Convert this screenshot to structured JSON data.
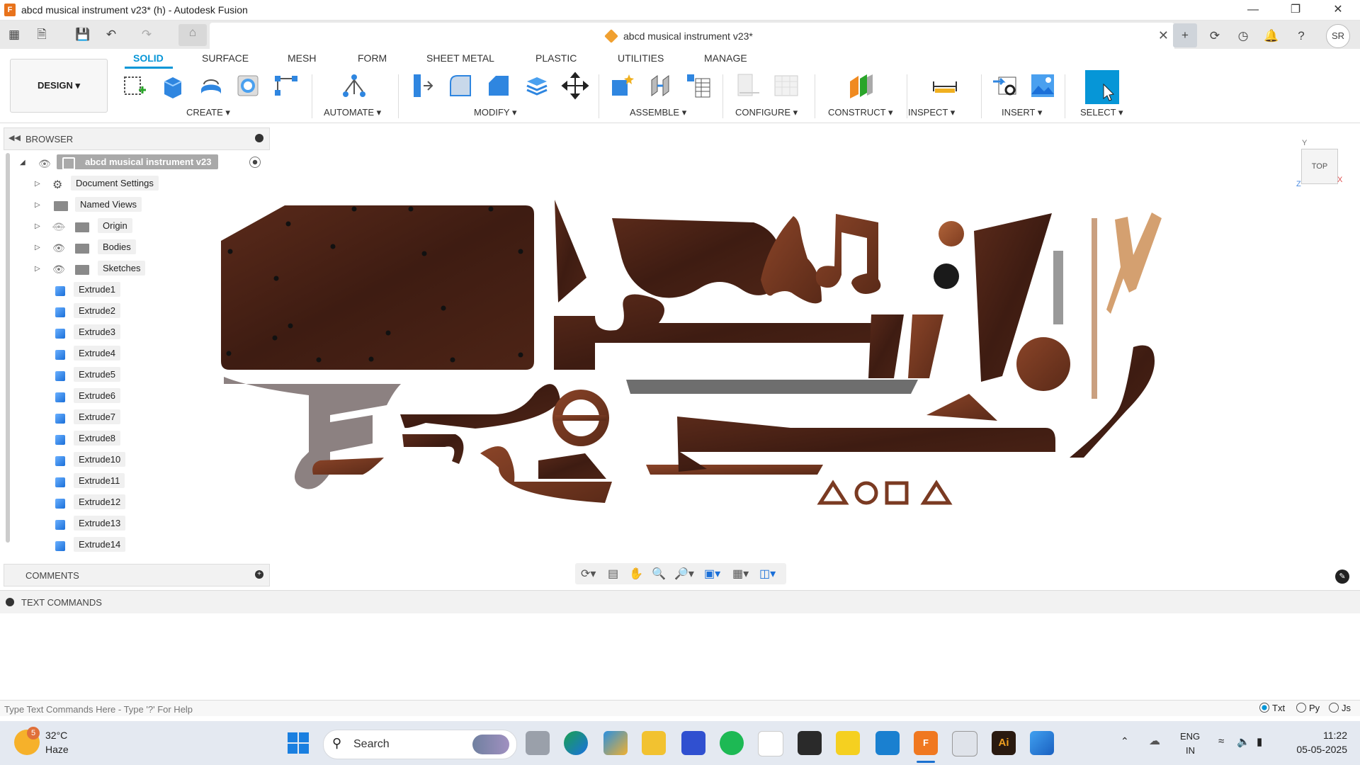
{
  "window": {
    "title": "abcd musical instrument v23* (h) - Autodesk Fusion",
    "app_icon": "F"
  },
  "tab": {
    "name": "abcd musical instrument v23*"
  },
  "ribbon": {
    "workspace": "DESIGN",
    "tabs": [
      "SOLID",
      "SURFACE",
      "MESH",
      "FORM",
      "SHEET METAL",
      "PLASTIC",
      "UTILITIES",
      "MANAGE"
    ],
    "groups": [
      "CREATE",
      "AUTOMATE",
      "MODIFY",
      "ASSEMBLE",
      "CONFIGURE",
      "CONSTRUCT",
      "INSPECT",
      "INSERT",
      "SELECT"
    ]
  },
  "browser": {
    "title": "BROWSER",
    "root": "abcd musical instrument v23",
    "folders": [
      "Document Settings",
      "Named Views",
      "Origin",
      "Bodies",
      "Sketches"
    ],
    "features": [
      "Extrude1",
      "Extrude2",
      "Extrude3",
      "Extrude4",
      "Extrude5",
      "Extrude6",
      "Extrude7",
      "Extrude8",
      "Extrude10",
      "Extrude11",
      "Extrude12",
      "Extrude13",
      "Extrude14"
    ]
  },
  "comments": {
    "title": "COMMENTS"
  },
  "text_commands": {
    "title": "TEXT COMMANDS",
    "placeholder": "Type Text Commands Here - Type '?' For Help",
    "modes": [
      "Txt",
      "Py",
      "Js"
    ]
  },
  "viewcube": {
    "face": "TOP",
    "axis_y": "Y",
    "axis_x": "X",
    "axis_z": "Z"
  },
  "profile": {
    "initials": "SR"
  },
  "taskbar": {
    "weather_temp": "32°C",
    "weather_desc": "Haze",
    "weather_badge": "5",
    "search": "Search",
    "lang1": "ENG",
    "lang2": "IN",
    "time": "11:22",
    "date": "05-05-2025"
  },
  "colors": {
    "accent": "#0696d7",
    "wood_dark": "#4a2418",
    "wood_mid": "#7a3a22",
    "wood_light": "#a0522d"
  }
}
